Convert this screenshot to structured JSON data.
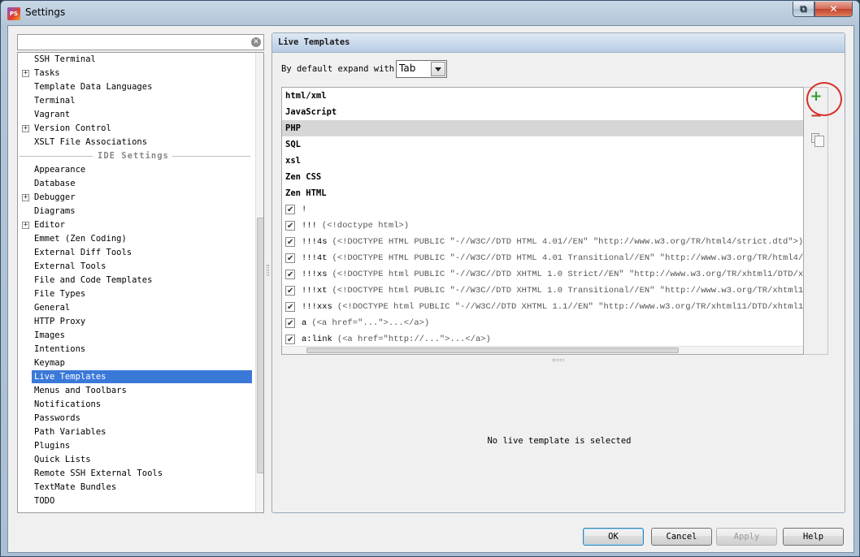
{
  "window": {
    "title": "Settings",
    "icon_text": "PS"
  },
  "search": {
    "value": "",
    "placeholder": ""
  },
  "tree": {
    "items": [
      {
        "label": "SSH Terminal",
        "expandable": false
      },
      {
        "label": "Tasks",
        "expandable": true
      },
      {
        "label": "Template Data Languages",
        "expandable": false
      },
      {
        "label": "Terminal",
        "expandable": false
      },
      {
        "label": "Vagrant",
        "expandable": false
      },
      {
        "label": "Version Control",
        "expandable": true
      },
      {
        "label": "XSLT File Associations",
        "expandable": false
      }
    ],
    "separator": "IDE Settings",
    "ide_items": [
      {
        "label": "Appearance",
        "expandable": false
      },
      {
        "label": "Database",
        "expandable": false
      },
      {
        "label": "Debugger",
        "expandable": true
      },
      {
        "label": "Diagrams",
        "expandable": false
      },
      {
        "label": "Editor",
        "expandable": true
      },
      {
        "label": "Emmet (Zen Coding)",
        "expandable": false
      },
      {
        "label": "External Diff Tools",
        "expandable": false
      },
      {
        "label": "External Tools",
        "expandable": false
      },
      {
        "label": "File and Code Templates",
        "expandable": false
      },
      {
        "label": "File Types",
        "expandable": false
      },
      {
        "label": "General",
        "expandable": false
      },
      {
        "label": "HTTP Proxy",
        "expandable": false
      },
      {
        "label": "Images",
        "expandable": false
      },
      {
        "label": "Intentions",
        "expandable": false
      },
      {
        "label": "Keymap",
        "expandable": false
      },
      {
        "label": "Live Templates",
        "expandable": false,
        "selected": true
      },
      {
        "label": "Menus and Toolbars",
        "expandable": false
      },
      {
        "label": "Notifications",
        "expandable": false
      },
      {
        "label": "Passwords",
        "expandable": false
      },
      {
        "label": "Path Variables",
        "expandable": false
      },
      {
        "label": "Plugins",
        "expandable": false
      },
      {
        "label": "Quick Lists",
        "expandable": false
      },
      {
        "label": "Remote SSH External Tools",
        "expandable": false
      },
      {
        "label": "TextMate Bundles",
        "expandable": false
      },
      {
        "label": "TODO",
        "expandable": false
      }
    ]
  },
  "panel": {
    "title": "Live Templates",
    "expand_label": "By default expand with",
    "expand_value": "Tab",
    "groups": [
      {
        "name": "html/xml"
      },
      {
        "name": "JavaScript"
      },
      {
        "name": "PHP",
        "selected": true
      },
      {
        "name": "SQL"
      },
      {
        "name": "xsl"
      },
      {
        "name": "Zen CSS"
      },
      {
        "name": "Zen HTML"
      }
    ],
    "templates": [
      {
        "abbr": "!",
        "desc": ""
      },
      {
        "abbr": "!!!",
        "desc": "(<!doctype html>)"
      },
      {
        "abbr": "!!!4s",
        "desc": "(<!DOCTYPE HTML PUBLIC \"-//W3C//DTD HTML 4.01//EN\" \"http://www.w3.org/TR/html4/strict.dtd\">)"
      },
      {
        "abbr": "!!!4t",
        "desc": "(<!DOCTYPE HTML PUBLIC \"-//W3C//DTD HTML 4.01 Transitional//EN\" \"http://www.w3.org/TR/html4/loose"
      },
      {
        "abbr": "!!!xs",
        "desc": "(<!DOCTYPE html PUBLIC \"-//W3C//DTD XHTML 1.0 Strict//EN\" \"http://www.w3.org/TR/xhtml1/DTD/xhtml1"
      },
      {
        "abbr": "!!!xt",
        "desc": "(<!DOCTYPE html PUBLIC \"-//W3C//DTD XHTML 1.0 Transitional//EN\" \"http://www.w3.org/TR/xhtml1/DTD/"
      },
      {
        "abbr": "!!!xxs",
        "desc": "(<!DOCTYPE html PUBLIC \"-//W3C//DTD XHTML 1.1//EN\" \"http://www.w3.org/TR/xhtml11/DTD/xhtml11.dtd"
      },
      {
        "abbr": "a",
        "desc": "(<a href=\"...\">...</a>)"
      },
      {
        "abbr": "a:link",
        "desc": "(<a href=\"http://...\">...</a>)"
      }
    ],
    "empty_message": "No live template is selected",
    "toolbar": {
      "add_icon": "plus-icon",
      "remove_icon": "minus-icon",
      "copy_icon": "copy-icon"
    }
  },
  "buttons": {
    "ok": "OK",
    "cancel": "Cancel",
    "apply": "Apply",
    "help": "Help"
  },
  "colors": {
    "selection": "#3a79d8",
    "add": "#2e9d2e",
    "remove": "#c8392b",
    "highlight_circle": "#d9302c"
  }
}
